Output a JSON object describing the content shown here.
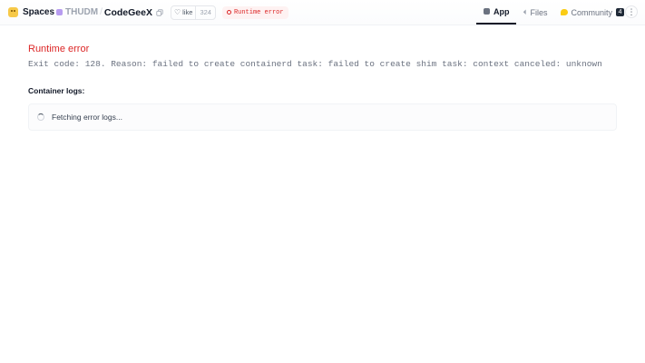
{
  "header": {
    "brand": {
      "label": "Spaces",
      "icon": "spaces-logo-icon"
    },
    "repo": {
      "org": "THUDM",
      "separator": "/",
      "name": "CodeGeeX"
    },
    "like": {
      "label": "like",
      "count": "324"
    },
    "status": {
      "label": "Runtime error",
      "color": "#dc2626"
    },
    "tabs": [
      {
        "label": "App",
        "icon": "app-icon",
        "active": true
      },
      {
        "label": "Files",
        "icon": "files-icon",
        "active": false
      },
      {
        "label": "Community",
        "icon": "community-icon",
        "active": false,
        "count": "4"
      }
    ],
    "menu_glyph": "⋮"
  },
  "main": {
    "error_title": "Runtime error",
    "error_message": "Exit code: 128. Reason: failed to create containerd task: failed to create shim task: context canceled: unknown",
    "logs_label": "Container logs:",
    "logs_status": "Fetching error logs..."
  },
  "colors": {
    "error": "#dc2626",
    "accent_yellow": "#f7c948"
  }
}
